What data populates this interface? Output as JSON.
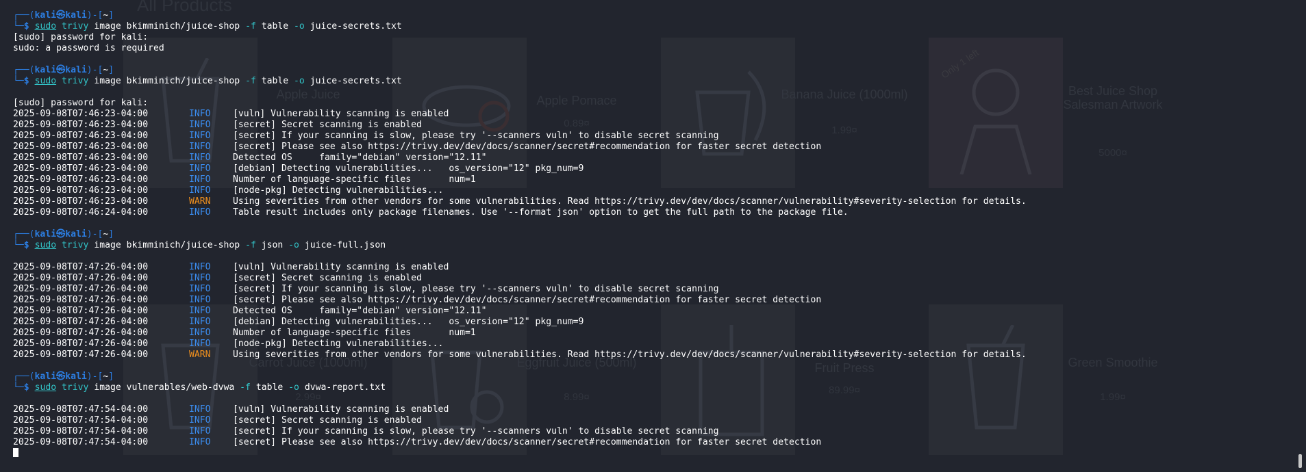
{
  "background_page": {
    "heading": "All Products",
    "products": [
      {
        "name": "Apple Juice",
        "price": ""
      },
      {
        "name": "Apple Pomace",
        "price": "0.89¤"
      },
      {
        "name": "Banana Juice (1000ml)",
        "price": "1.99¤"
      },
      {
        "name": "Best Juice Shop Salesman Artwork",
        "price": "5000¤"
      },
      {
        "name": "Carrot Juice (1000ml)",
        "price": "2.99¤"
      },
      {
        "name": "Eggfruit Juice (500ml)",
        "price": "8.99¤"
      },
      {
        "name": "Fruit Press",
        "price": "89.99¤"
      },
      {
        "name": "Green Smoothie",
        "price": "1.99¤"
      }
    ],
    "badge": "Only 1 left"
  },
  "terminal": {
    "user": "kali",
    "host": "kali",
    "cwd": "~",
    "blocks": [
      {
        "command": {
          "sudo": "sudo",
          "prog": "trivy",
          "a1": "image bkimminich/juice-shop",
          "f": "-f",
          "a2": "table",
          "o": "-o",
          "a3": "juice-secrets.txt"
        },
        "output": [
          {
            "text": "[sudo] password for kali:"
          },
          {
            "text": "sudo: a password is required"
          }
        ]
      },
      {
        "command": {
          "sudo": "sudo",
          "prog": "trivy",
          "a1": "image bkimminich/juice-shop",
          "f": "-f",
          "a2": "table",
          "o": "-o",
          "a3": "juice-secrets.txt"
        },
        "output": [
          {
            "text": ""
          },
          {
            "text": "[sudo] password for kali:"
          },
          {
            "ts": "2025-09-08T07:46:23-04:00",
            "level": "INFO",
            "msg": "[vuln] Vulnerability scanning is enabled"
          },
          {
            "ts": "2025-09-08T07:46:23-04:00",
            "level": "INFO",
            "msg": "[secret] Secret scanning is enabled"
          },
          {
            "ts": "2025-09-08T07:46:23-04:00",
            "level": "INFO",
            "msg": "[secret] If your scanning is slow, please try '--scanners vuln' to disable secret scanning"
          },
          {
            "ts": "2025-09-08T07:46:23-04:00",
            "level": "INFO",
            "msg": "[secret] Please see also https://trivy.dev/dev/docs/scanner/secret#recommendation for faster secret detection"
          },
          {
            "ts": "2025-09-08T07:46:23-04:00",
            "level": "INFO",
            "msg": "Detected OS     family=\"debian\" version=\"12.11\""
          },
          {
            "ts": "2025-09-08T07:46:23-04:00",
            "level": "INFO",
            "msg": "[debian] Detecting vulnerabilities...   os_version=\"12\" pkg_num=9"
          },
          {
            "ts": "2025-09-08T07:46:23-04:00",
            "level": "INFO",
            "msg": "Number of language-specific files       num=1"
          },
          {
            "ts": "2025-09-08T07:46:23-04:00",
            "level": "INFO",
            "msg": "[node-pkg] Detecting vulnerabilities..."
          },
          {
            "ts": "2025-09-08T07:46:23-04:00",
            "level": "WARN",
            "msg": "Using severities from other vendors for some vulnerabilities. Read https://trivy.dev/dev/docs/scanner/vulnerability#severity-selection for details."
          },
          {
            "ts": "2025-09-08T07:46:24-04:00",
            "level": "INFO",
            "msg": "Table result includes only package filenames. Use '--format json' option to get the full path to the package file."
          }
        ]
      },
      {
        "command": {
          "sudo": "sudo",
          "prog": "trivy",
          "a1": "image bkimminich/juice-shop",
          "f": "-f",
          "a2": "json",
          "o": "-o",
          "a3": "juice-full.json"
        },
        "output": [
          {
            "text": ""
          },
          {
            "ts": "2025-09-08T07:47:26-04:00",
            "level": "INFO",
            "msg": "[vuln] Vulnerability scanning is enabled"
          },
          {
            "ts": "2025-09-08T07:47:26-04:00",
            "level": "INFO",
            "msg": "[secret] Secret scanning is enabled"
          },
          {
            "ts": "2025-09-08T07:47:26-04:00",
            "level": "INFO",
            "msg": "[secret] If your scanning is slow, please try '--scanners vuln' to disable secret scanning"
          },
          {
            "ts": "2025-09-08T07:47:26-04:00",
            "level": "INFO",
            "msg": "[secret] Please see also https://trivy.dev/dev/docs/scanner/secret#recommendation for faster secret detection"
          },
          {
            "ts": "2025-09-08T07:47:26-04:00",
            "level": "INFO",
            "msg": "Detected OS     family=\"debian\" version=\"12.11\""
          },
          {
            "ts": "2025-09-08T07:47:26-04:00",
            "level": "INFO",
            "msg": "[debian] Detecting vulnerabilities...   os_version=\"12\" pkg_num=9"
          },
          {
            "ts": "2025-09-08T07:47:26-04:00",
            "level": "INFO",
            "msg": "Number of language-specific files       num=1"
          },
          {
            "ts": "2025-09-08T07:47:26-04:00",
            "level": "INFO",
            "msg": "[node-pkg] Detecting vulnerabilities..."
          },
          {
            "ts": "2025-09-08T07:47:26-04:00",
            "level": "WARN",
            "msg": "Using severities from other vendors for some vulnerabilities. Read https://trivy.dev/dev/docs/scanner/vulnerability#severity-selection for details."
          }
        ]
      },
      {
        "command": {
          "sudo": "sudo",
          "prog": "trivy",
          "a1": "image vulnerables/web-dvwa",
          "f": "-f",
          "a2": "table",
          "o": "-o",
          "a3": "dvwa-report.txt"
        },
        "output": [
          {
            "text": ""
          },
          {
            "ts": "2025-09-08T07:47:54-04:00",
            "level": "INFO",
            "msg": "[vuln] Vulnerability scanning is enabled"
          },
          {
            "ts": "2025-09-08T07:47:54-04:00",
            "level": "INFO",
            "msg": "[secret] Secret scanning is enabled"
          },
          {
            "ts": "2025-09-08T07:47:54-04:00",
            "level": "INFO",
            "msg": "[secret] If your scanning is slow, please try '--scanners vuln' to disable secret scanning"
          },
          {
            "ts": "2025-09-08T07:47:54-04:00",
            "level": "INFO",
            "msg": "[secret] Please see also https://trivy.dev/dev/docs/scanner/secret#recommendation for faster secret detection"
          }
        ]
      }
    ],
    "colors": {
      "prompt": "#2c7de0",
      "command": "#32c4c8",
      "info": "#3b8df0",
      "warn": "#f0901e",
      "background": "#22252e"
    }
  }
}
